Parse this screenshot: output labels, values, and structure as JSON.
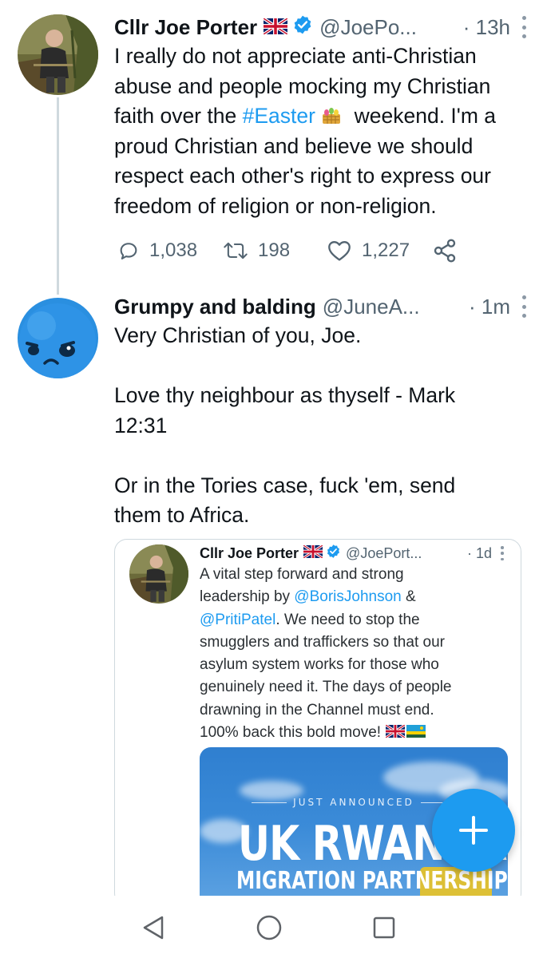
{
  "tweets": [
    {
      "name": "Cllr Joe Porter",
      "handle": "@JoePo...",
      "time": "· 13h",
      "text_before_tag": "I really do not appreciate anti-Christian\nabuse and people mocking my Christian\nfaith over the ",
      "hashtag": "#Easter",
      "text_after_tag": "  weekend. I'm a\nproud Christian and believe we should\nrespect each other's right to express our\nfreedom of religion or non-religion.",
      "stats": {
        "replies": "1,038",
        "retweets": "198",
        "likes": "1,227"
      }
    },
    {
      "name": "Grumpy and balding",
      "handle": "@JuneA...",
      "time": "· 1m",
      "text": "Very Christian of you, Joe.\n\nLove thy neighbour as thyself - Mark\n12:31\n\nOr in the Tories case, fuck 'em, send\nthem to Africa."
    }
  ],
  "quote": {
    "name": "Cllr Joe Porter",
    "handle": "@JoePort...",
    "time": "· 1d",
    "text_1": "A vital step forward and strong\nleadership by ",
    "mention_1": "@BorisJohnson",
    "text_2": " &\n",
    "mention_2": "@PritiPatel",
    "text_3": ". We need to stop the\nsmugglers and traffickers so that our\nasylum system works for those who\ngenuinely need it. The days of people\ndrawning in the Channel must end.\n100% back this bold move!",
    "image": {
      "subtitle": "JUST ANNOUNCED",
      "title": "UK RWANDA",
      "title_2": "MIGRATION PARTNERSHIP"
    }
  },
  "colors": {
    "accent": "#1d9bf0",
    "text": "#0f1419",
    "secondary": "#536471",
    "border": "#cfd9de"
  },
  "icons": [
    "more-vertical-icon",
    "verified-badge-icon",
    "uk-flag-icon",
    "easter-basket-icon",
    "reply-icon",
    "retweet-icon",
    "like-icon",
    "share-icon",
    "compose-plus-icon",
    "nav-back-icon",
    "nav-home-icon",
    "nav-recents-icon"
  ]
}
